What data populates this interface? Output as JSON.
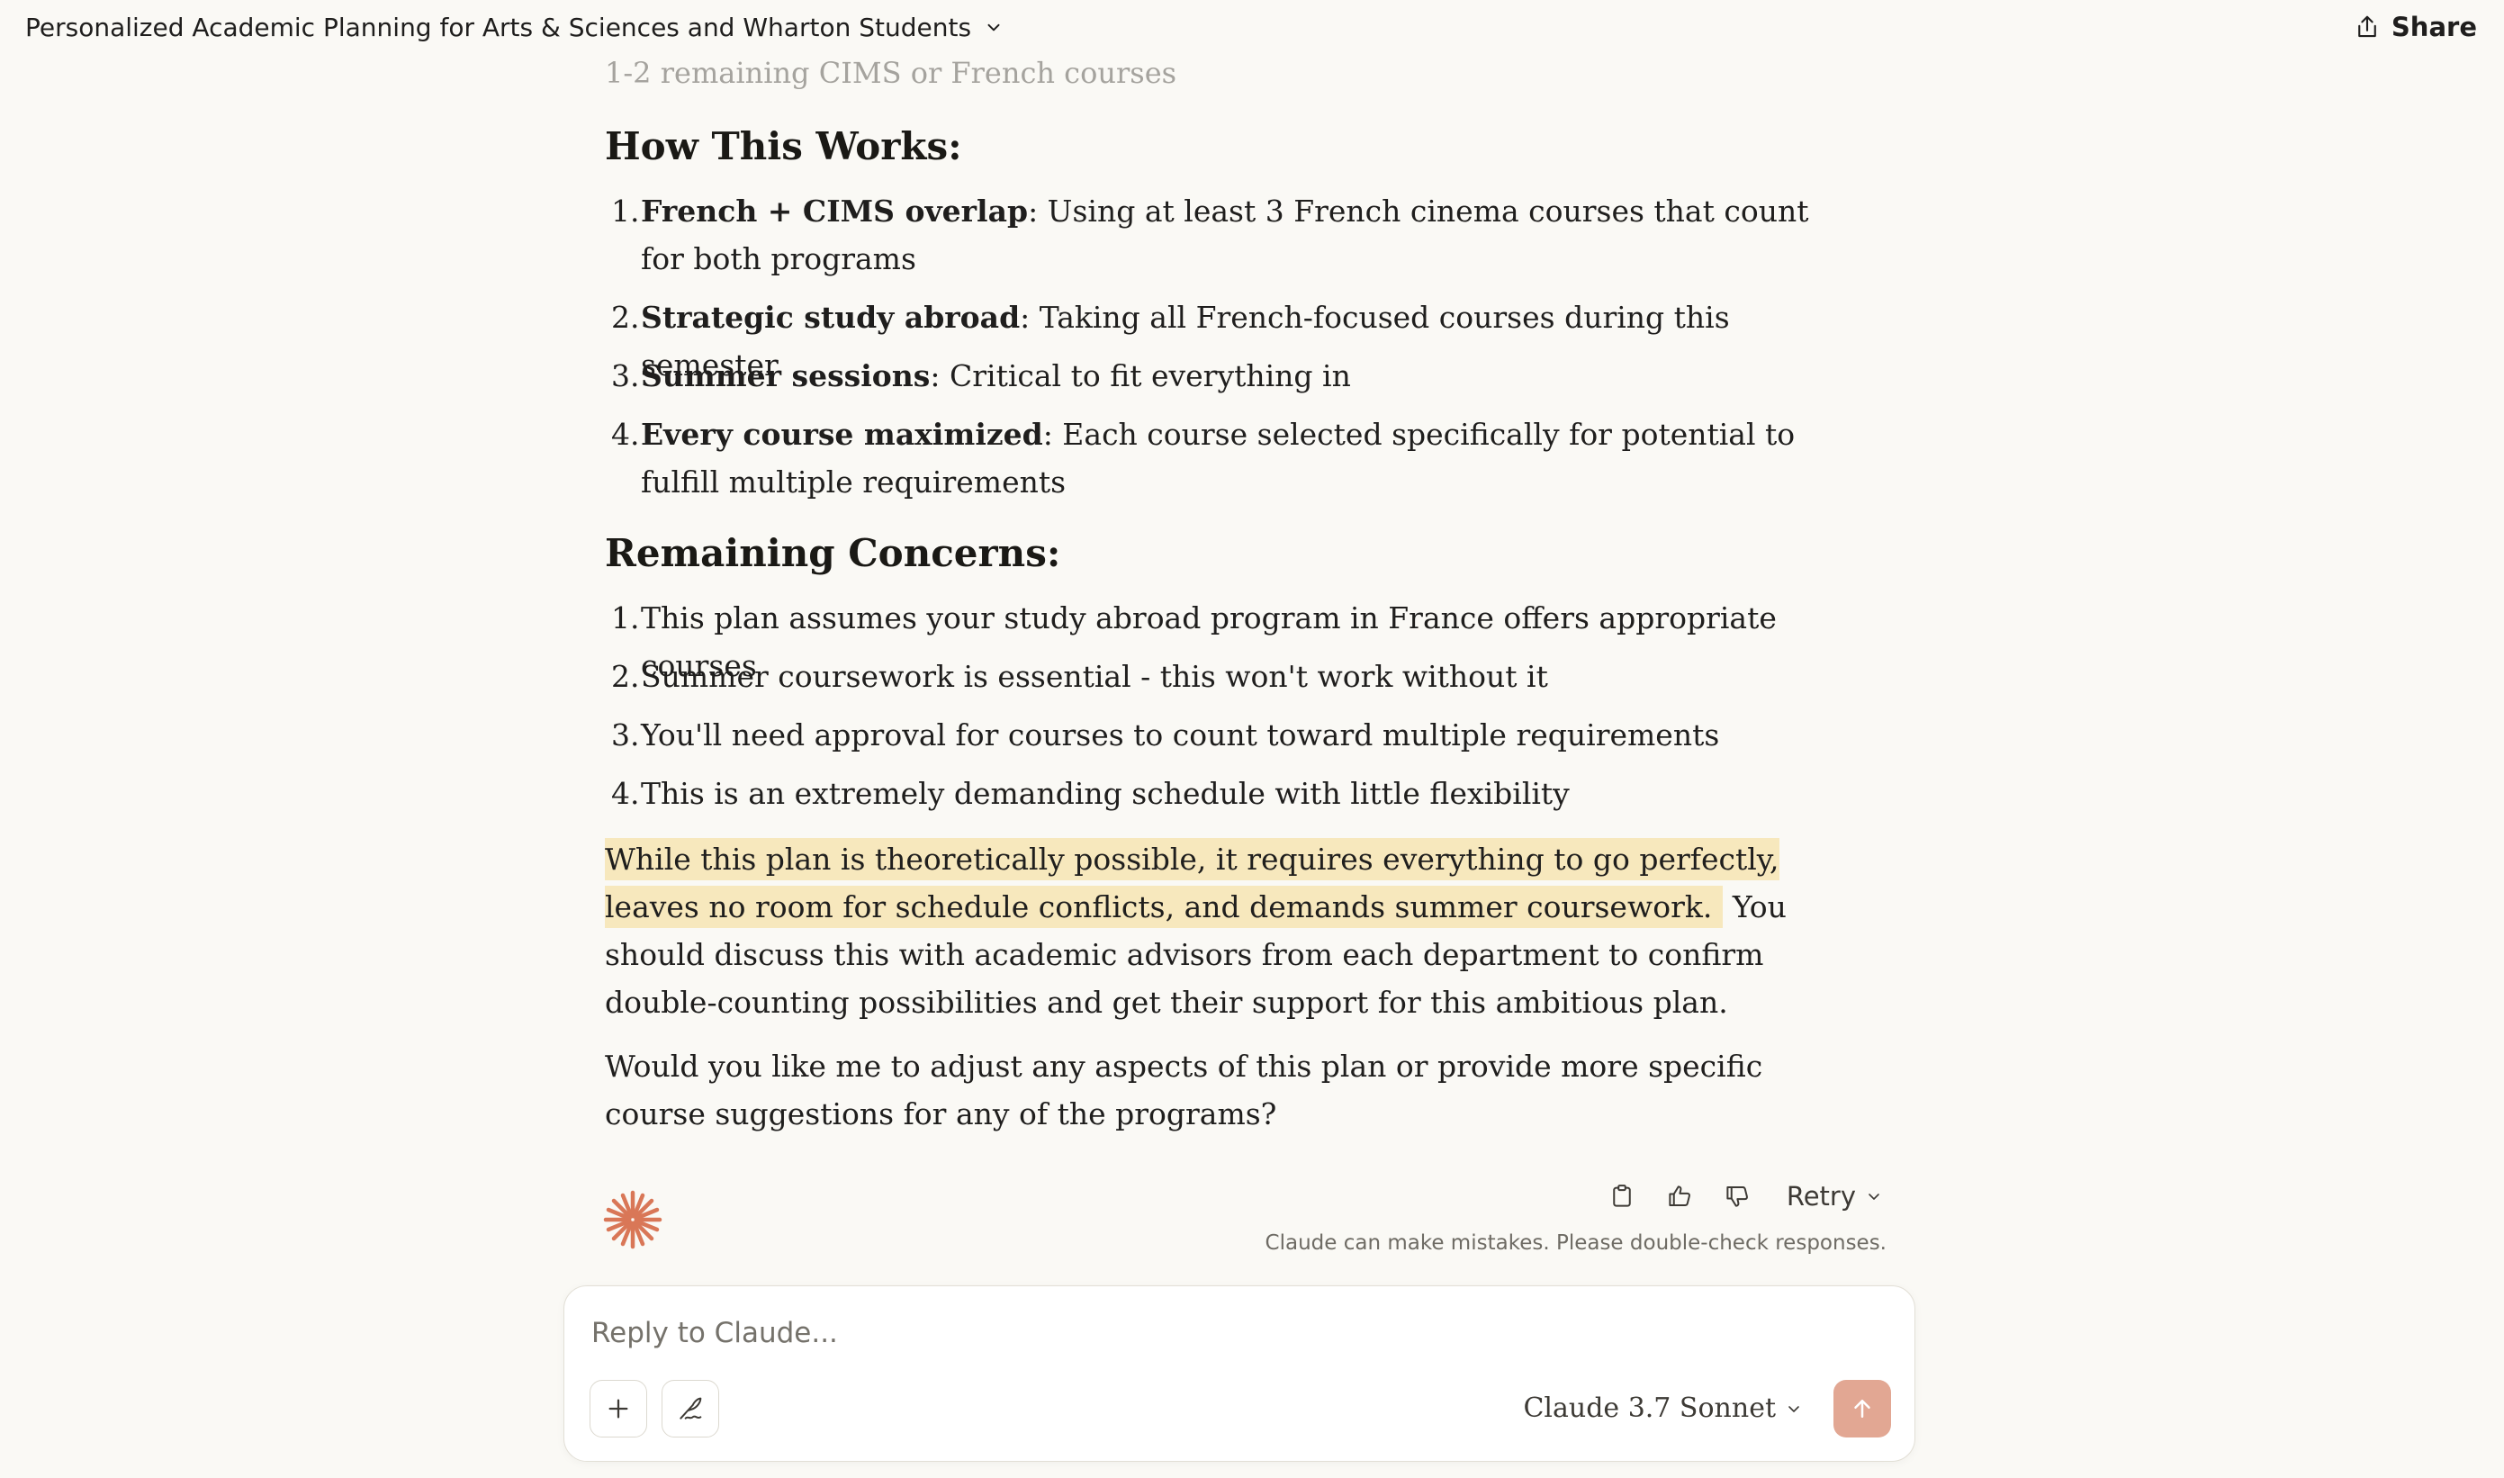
{
  "header": {
    "title": "Personalized Academic Planning for Arts & Sciences and Wharton Students",
    "share_label": "Share"
  },
  "message": {
    "faded_top_line": "1-2 remaining CIMS or French courses",
    "how_heading": "How This Works:",
    "how_items": [
      {
        "num": "1.",
        "bold": "French + CIMS overlap",
        "text": ": Using at least 3 French cinema courses that count for both programs"
      },
      {
        "num": "2.",
        "bold": "Strategic study abroad",
        "text": ": Taking all French-focused courses during this semester"
      },
      {
        "num": "3.",
        "bold": "Summer sessions",
        "text": ": Critical to fit everything in"
      },
      {
        "num": "4.",
        "bold": "Every course maximized",
        "text": ": Each course selected specifically for potential to fulfill multiple requirements"
      }
    ],
    "concerns_heading": "Remaining Concerns:",
    "concern_items": [
      {
        "num": "1.",
        "text": "This plan assumes your study abroad program in France offers appropriate courses"
      },
      {
        "num": "2.",
        "text": "Summer coursework is essential - this won't work without it"
      },
      {
        "num": "3.",
        "text": "You'll need approval for courses to count toward multiple requirements"
      },
      {
        "num": "4.",
        "text": "This is an extremely demanding schedule with little flexibility"
      }
    ],
    "closing_highlight": "While this plan is theoretically possible, it requires everything to go perfectly, leaves no room for schedule conflicts, and demands summer coursework.",
    "closing_rest": " You should discuss this with academic advisors from each department to confirm double-counting possibilities and get their support for this ambitious plan.",
    "question": "Would you like me to adjust any aspects of this plan or provide more specific course suggestions for any of the programs?"
  },
  "actions": {
    "copy_icon": "clipboard-icon",
    "thumbs_up_icon": "thumbs-up-icon",
    "thumbs_down_icon": "thumbs-down-icon",
    "retry_label": "Retry",
    "disclaimer": "Claude can make mistakes. Please double-check responses."
  },
  "composer": {
    "placeholder": "Reply to Claude...",
    "model_label": "Claude 3.7 Sonnet"
  },
  "colors": {
    "background": "#faf9f5",
    "highlight": "#f7e8bd",
    "accent": "#d97757",
    "send_button": "#e2a793"
  }
}
